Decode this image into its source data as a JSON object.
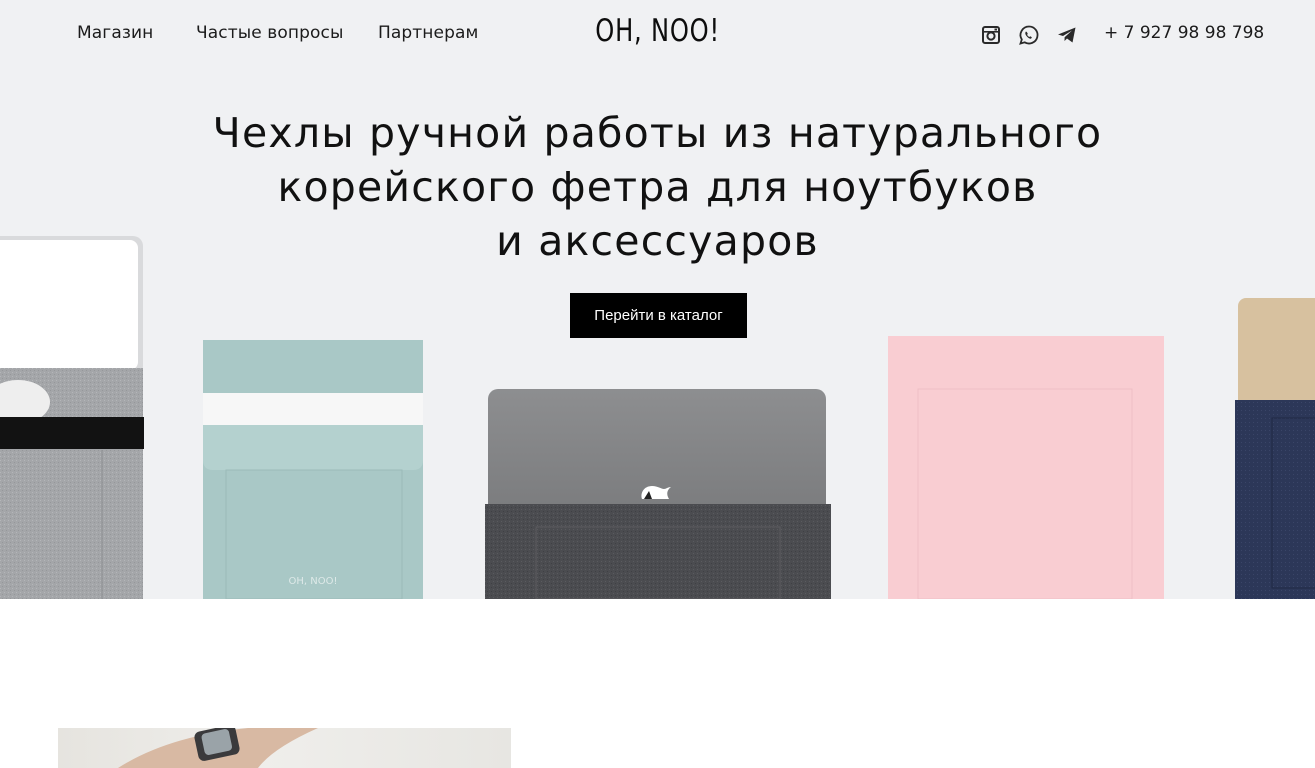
{
  "nav": {
    "links": [
      "Магазин",
      "Частые вопросы",
      "Партнерам"
    ],
    "logo": "OH, NOO!",
    "social_icons": [
      "instagram-icon",
      "whatsapp-icon",
      "telegram-icon"
    ],
    "phone": "+ 7 927 98 98 798"
  },
  "hero": {
    "headline_lines": [
      "Чехлы ручной работы из натурального",
      "корейского фетра для ноутбуков",
      "и аксессуаров"
    ],
    "cta_label": "Перейти в каталог",
    "sleeve_brand_mark": "OH, NOO!",
    "products": [
      "grey-felt-sleeve",
      "mint-felt-sleeve",
      "dark-grey-laptop-sleeve",
      "pink-felt-sleeve",
      "navy-felt-sleeve"
    ]
  },
  "colors": {
    "hero_background": "#f0f1f3",
    "cta_background": "#000000",
    "mint": "#a9c8c6",
    "pink": "#f9cdd2",
    "navy": "#2b3656",
    "dark_felt": "#4a4b4f",
    "light_felt": "#a7a9ac"
  }
}
